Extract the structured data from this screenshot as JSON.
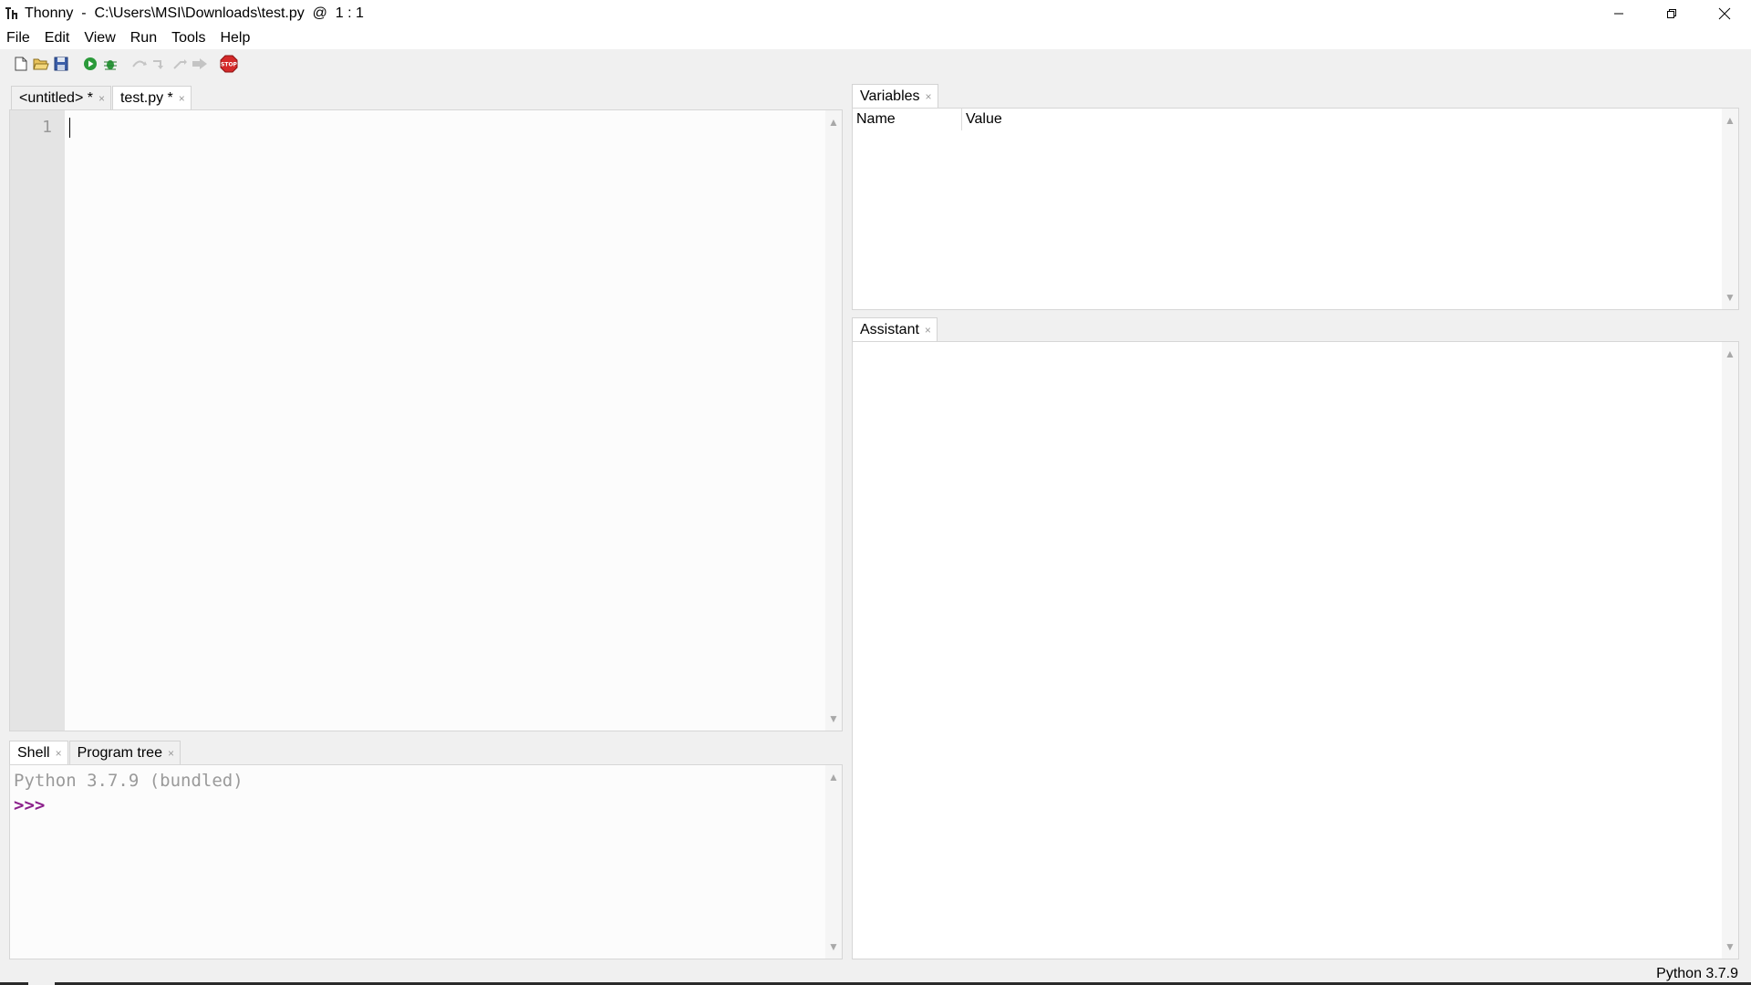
{
  "window": {
    "app_name": "Thonny",
    "title": "Thonny  -  C:\\Users\\MSI\\Downloads\\test.py  @  1 : 1",
    "controls": [
      "minimize",
      "maximize",
      "close"
    ]
  },
  "menu": {
    "items": [
      {
        "label": "File"
      },
      {
        "label": "Edit"
      },
      {
        "label": "View"
      },
      {
        "label": "Run"
      },
      {
        "label": "Tools"
      },
      {
        "label": "Help"
      }
    ]
  },
  "toolbar": {
    "buttons": [
      "new-file-icon",
      "open-file-icon",
      "save-icon",
      "run-icon",
      "debug-icon",
      "step-over-icon",
      "step-into-icon",
      "step-out-icon",
      "resume-icon",
      "stop-icon"
    ],
    "stop_label": "STOP"
  },
  "editor": {
    "tabs": [
      {
        "label": "<untitled> *",
        "close": "×"
      },
      {
        "label": "test.py *",
        "close": "×"
      }
    ],
    "active_tab": 1,
    "line_numbers": [
      "1"
    ]
  },
  "shell_panel": {
    "tabs": [
      {
        "label": "Shell",
        "close": "×"
      },
      {
        "label": "Program tree",
        "close": "×"
      }
    ],
    "banner": "Python 3.7.9 (bundled)",
    "prompt": ">>>"
  },
  "variables_panel": {
    "tab": {
      "label": "Variables",
      "close": "×"
    },
    "columns": [
      "Name",
      "Value"
    ]
  },
  "assistant_panel": {
    "tab": {
      "label": "Assistant",
      "close": "×"
    }
  },
  "status": {
    "interpreter": "Python 3.7.9"
  },
  "colors": {
    "prompt": "#8b1f8b",
    "banner": "#9a9a9a",
    "gutter": "#e4e4e4",
    "stop": "#d42a2a",
    "run": "#2b9a3a"
  }
}
